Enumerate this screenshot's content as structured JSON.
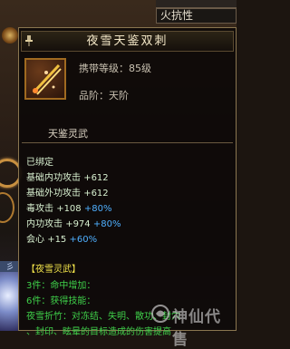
{
  "top_list": {
    "item_label": "火抗性"
  },
  "tooltip": {
    "title": "夜雪天鉴双刺",
    "carry_level": "携带等级：85级",
    "grade": "品阶：天阶",
    "category": "天鉴灵武"
  },
  "stats": {
    "bind_status": "已绑定",
    "rows": [
      {
        "label": "基础内功攻击",
        "value": "+612",
        "bonus": ""
      },
      {
        "label": "基础外功攻击",
        "value": "+612",
        "bonus": ""
      },
      {
        "label": "毒攻击",
        "value": "+108",
        "bonus": "+80%"
      },
      {
        "label": "内功攻击",
        "value": "+974",
        "bonus": "+80%"
      },
      {
        "label": "会心",
        "value": "+15",
        "bonus": "+60%"
      }
    ]
  },
  "set": {
    "title": "【夜雪灵武】",
    "lines": [
      "3件：命中增加：",
      "6件：获得技能：",
      "夜雪折竹：对冻结、失明、散功、封穴",
      "、封印、眩晕的目标造成的伤害提高"
    ]
  },
  "watermark": {
    "text": "神仙代售"
  },
  "colors": {
    "title": "#f4e8c8",
    "stat_text": "#d8f0d0",
    "stat_bonus": "#4fb0ff",
    "set_title": "#f0e24a",
    "set_text": "#3fd04a",
    "border": "#8a7650"
  }
}
